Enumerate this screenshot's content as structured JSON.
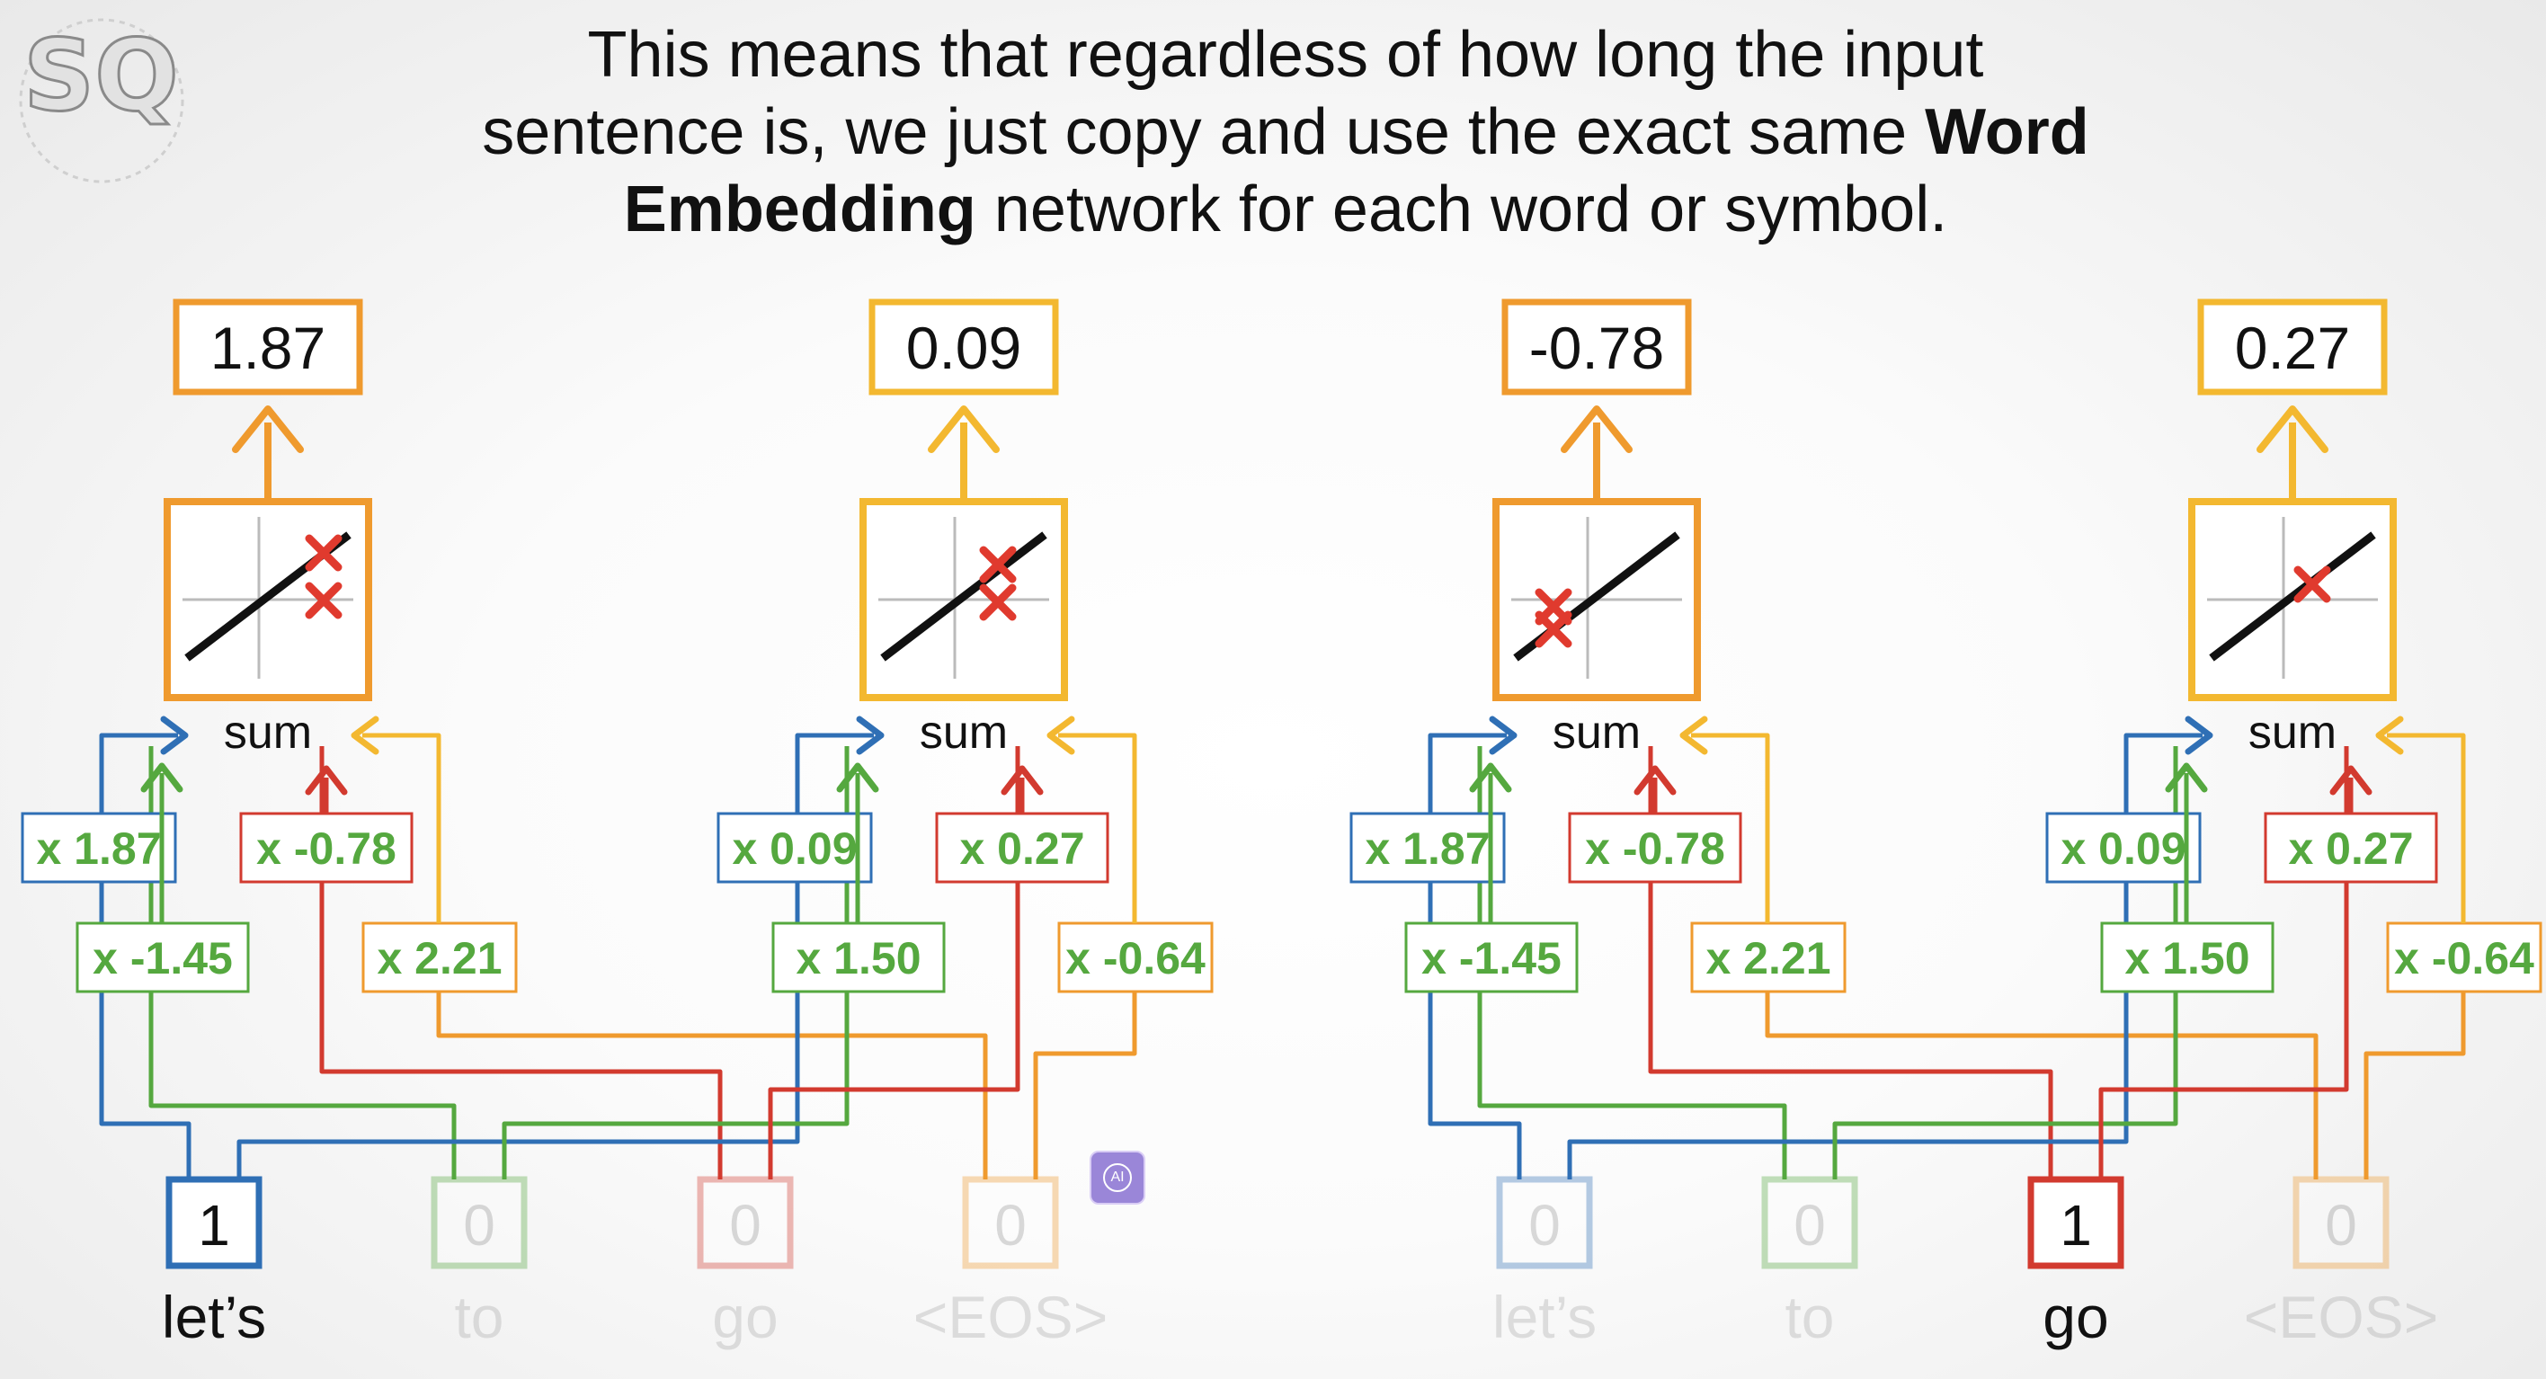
{
  "caption": {
    "line1": "This means that regardless of how long the input",
    "line2_pre": "sentence is, we just copy and use the exact same ",
    "line2_bold": "Word",
    "line3_bold": "Embedding",
    "line3_post": " network for each word or symbol."
  },
  "colors": {
    "blue": "#2f6fb5",
    "green": "#55a83f",
    "red": "#d23a2f",
    "orange": "#ef9a2e",
    "yellow": "#f3b830",
    "x_marker": "#e03a2e"
  },
  "sum_label": "sum",
  "networks": [
    {
      "id": "left",
      "words": [
        {
          "label": "let’s",
          "value": "1",
          "active": true,
          "color": "#2f6fb5"
        },
        {
          "label": "to",
          "value": "0",
          "active": false,
          "color": "#55a83f"
        },
        {
          "label": "go",
          "value": "0",
          "active": false,
          "color": "#d23a2f"
        },
        {
          "label": "<EOS>",
          "value": "0",
          "active": false,
          "color": "#ef9a2e"
        }
      ],
      "nodes": [
        {
          "output": "1.87",
          "box_color": "#ef9a2e",
          "weights": {
            "blue": "x 1.87",
            "green": "x -1.45",
            "red": "x -0.78",
            "orange": "x 2.21"
          }
        },
        {
          "output": "0.09",
          "box_color": "#f3b830",
          "weights": {
            "blue": "x 0.09",
            "green": "x 1.50",
            "red": "x 0.27",
            "orange": "x -0.64"
          }
        }
      ]
    },
    {
      "id": "right",
      "words": [
        {
          "label": "let’s",
          "value": "0",
          "active": false,
          "color": "#2f6fb5"
        },
        {
          "label": "to",
          "value": "0",
          "active": false,
          "color": "#55a83f"
        },
        {
          "label": "go",
          "value": "1",
          "active": true,
          "color": "#d23a2f"
        },
        {
          "label": "<EOS>",
          "value": "0",
          "active": false,
          "color": "#ef9a2e"
        }
      ],
      "nodes": [
        {
          "output": "-0.78",
          "box_color": "#ef9a2e",
          "weights": {
            "blue": "x 1.87",
            "green": "x -1.45",
            "red": "x -0.78",
            "orange": "x 2.21"
          }
        },
        {
          "output": "0.27",
          "box_color": "#f3b830",
          "weights": {
            "blue": "x 0.09",
            "green": "x 1.50",
            "red": "x 0.27",
            "orange": "x -0.64"
          }
        }
      ]
    }
  ],
  "logo_text": "SQ",
  "ai_badge": "AI"
}
